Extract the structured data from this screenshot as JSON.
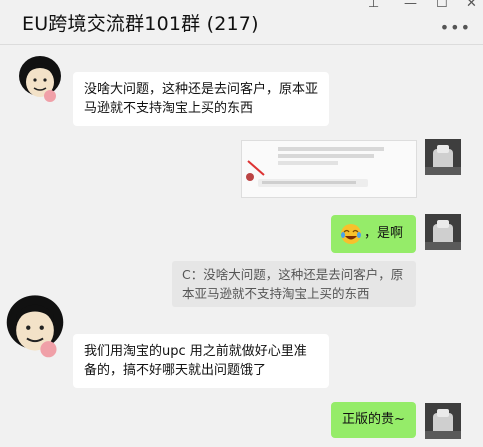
{
  "window": {
    "title": "EU跨境交流群101群 (217)",
    "pin_glyph": "⊥",
    "minimize_glyph": "—",
    "maximize_glyph": "☐",
    "close_glyph": "✕",
    "more_glyph": "•••"
  },
  "messages": [
    {
      "side": "left",
      "text": "没啥大问题，这种还是去问客户，原本亚马逊就不支持淘宝上买的东西"
    },
    {
      "side": "right",
      "type": "image-screenshot"
    },
    {
      "side": "right",
      "emoji": "grinning-tears-emoji",
      "text": "，是啊"
    },
    {
      "side": "right",
      "type": "quote",
      "text": "C：没啥大问题，这种还是去问客户，原本亚马逊就不支持淘宝上买的东西"
    },
    {
      "side": "left",
      "text": "我们用淘宝的upc 用之前就做好心里准备的，搞不好哪天就出问题饿了"
    },
    {
      "side": "right",
      "text": "正版的贵~"
    }
  ],
  "colors": {
    "self_bubble": "#95ec69",
    "other_bubble": "#ffffff",
    "background": "#f1f1f1"
  }
}
